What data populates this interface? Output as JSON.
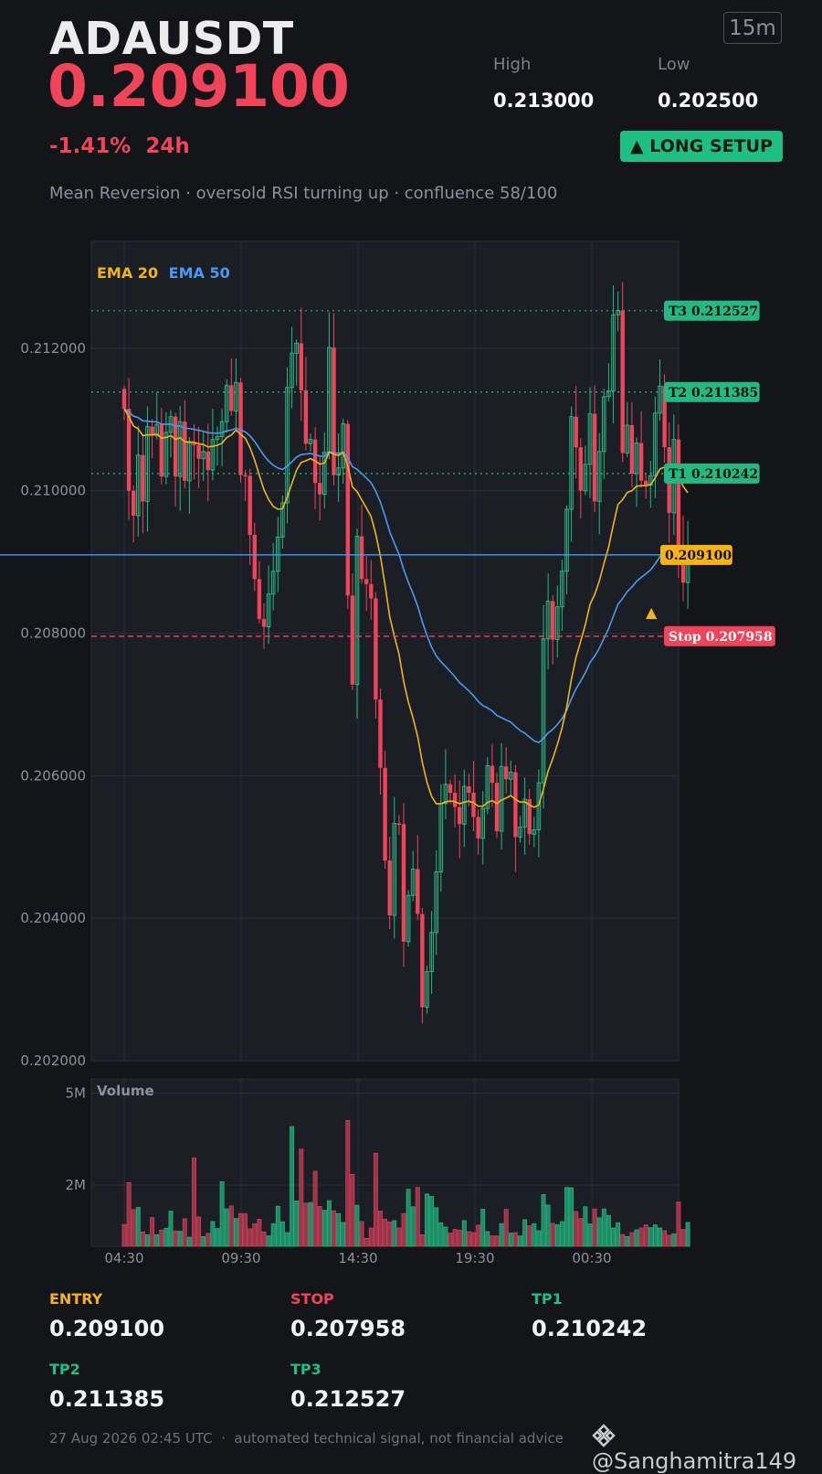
{
  "header": {
    "symbol": "ADAUSDT",
    "price": "0.209100",
    "interval": "15m",
    "high_label": "High",
    "high_value": "0.213000",
    "low_label": "Low",
    "low_value": "0.202500",
    "change": "-1.41%  24h",
    "signal": "▲ LONG SETUP",
    "strategy": "Mean Reversion · oversold RSI turning up · confluence 58/100"
  },
  "chart_data": [
    {
      "type": "candlestick",
      "legend": [
        {
          "name": "EMA 20",
          "color": "#f2b418"
        },
        {
          "name": "EMA 50",
          "color": "#4a9bf0"
        }
      ],
      "y_ticks": [
        "0.212000",
        "0.210000",
        "0.208000",
        "0.206000",
        "0.204000",
        "0.202000"
      ],
      "ylim": [
        0.202,
        0.2135
      ],
      "x_ticks": [
        "04:30",
        "09:30",
        "14:30",
        "19:30",
        "00:30"
      ],
      "levels": [
        {
          "name": "T3",
          "value": 0.212527,
          "label": "T3 0.212527",
          "color": "#26b883"
        },
        {
          "name": "T2",
          "value": 0.211385,
          "label": "T2 0.211385",
          "color": "#26b883"
        },
        {
          "name": "T1",
          "value": 0.210242,
          "label": "T1 0.210242",
          "color": "#26b883"
        },
        {
          "name": "Last",
          "value": 0.2091,
          "label": "0.209100",
          "color": "#f5b316"
        },
        {
          "name": "Stop",
          "value": 0.207958,
          "label": "Stop 0.207958",
          "color": "#f0445a"
        }
      ],
      "entry_marker": "▲",
      "close": [
        0.21115,
        0.21,
        0.20965,
        0.2105,
        0.20985,
        0.2109,
        0.21077,
        0.21093,
        0.2102,
        0.21082,
        0.21104,
        0.2102,
        0.21097,
        0.21014,
        0.21067,
        0.21064,
        0.21045,
        0.21055,
        0.21029,
        0.21072,
        0.21076,
        0.21097,
        0.21148,
        0.21112,
        0.21152,
        0.21022,
        0.21021,
        0.20938,
        0.20876,
        0.2082,
        0.20809,
        0.20855,
        0.20887,
        0.20935,
        0.20983,
        0.21145,
        0.21193,
        0.21207,
        0.21141,
        0.21066,
        0.21072,
        0.21011,
        0.20995,
        0.21054,
        0.21201,
        0.21022,
        0.21032,
        0.21094,
        0.20853,
        0.20728,
        0.20936,
        0.20876,
        0.20869,
        0.20849,
        0.20707,
        0.20611,
        0.20481,
        0.20404,
        0.20533,
        0.20532,
        0.20367,
        0.20432,
        0.20469,
        0.20406,
        0.20275,
        0.20325,
        0.2038,
        0.20465,
        0.20561,
        0.20588,
        0.20576,
        0.20556,
        0.20532,
        0.20585,
        0.20576,
        0.20542,
        0.20512,
        0.20554,
        0.20614,
        0.2059,
        0.20522,
        0.20613,
        0.20595,
        0.20605,
        0.20514,
        0.20528,
        0.20567,
        0.20518,
        0.20524,
        0.2059,
        0.20792,
        0.20845,
        0.20791,
        0.20837,
        0.20887,
        0.20974,
        0.21104,
        0.21061,
        0.21,
        0.21037,
        0.21108,
        0.20985,
        0.21055,
        0.21132,
        0.2114,
        0.21247,
        0.21253,
        0.21053,
        0.21092,
        0.21024,
        0.21067,
        0.21014,
        0.21008,
        0.21021,
        0.21109,
        0.21147,
        0.21061,
        0.20969,
        0.21072,
        0.20916,
        0.20871,
        0.2091
      ]
    },
    {
      "type": "bar",
      "title": "Volume",
      "y_ticks": [
        "5M",
        "2M"
      ],
      "values": [
        0.71,
        2.08,
        1.2,
        1.27,
        0.47,
        0.38,
        0.94,
        0.38,
        0.53,
        0.59,
        1.15,
        0.5,
        0.49,
        0.9,
        0.3,
        2.89,
        0.96,
        0.32,
        0.42,
        0.81,
        0.58,
        2.11,
        1.22,
        1.32,
        0.91,
        1.07,
        1.06,
        0.57,
        0.74,
        0.88,
        0.47,
        0.34,
        0.74,
        1.31,
        0.8,
        0.45,
        3.91,
        1.48,
        3.17,
        1.41,
        1.43,
        2.45,
        1.3,
        1.18,
        1.49,
        1.16,
        1.07,
        0.78,
        4.11,
        2.35,
        1.34,
        0.81,
        0.26,
        0.6,
        3.04,
        1.15,
        0.89,
        0.8,
        0.84,
        0.6,
        1.07,
        1.86,
        1.29,
        1.92,
        0.38,
        1.71,
        1.63,
        1.26,
        0.77,
        0.63,
        0.43,
        0.55,
        0.53,
        0.84,
        0.48,
        0.45,
        0.69,
        1.21,
        0.48,
        0.34,
        0.34,
        0.74,
        1.21,
        0.43,
        0.45,
        0.34,
        0.87,
        0.67,
        0.74,
        0.51,
        1.69,
        1.35,
        0.75,
        0.71,
        0.81,
        1.92,
        1.91,
        1.14,
        0.91,
        1.29,
        0.73,
        1.22,
        0.93,
        1.22,
        1.01,
        0.6,
        0.77,
        0.39,
        0.32,
        0.45,
        0.54,
        0.6,
        0.7,
        0.61,
        0.7,
        0.6,
        0.51,
        0.36,
        0.41,
        1.45,
        0.55,
        0.78
      ]
    }
  ],
  "summary": [
    {
      "label": "ENTRY",
      "value": "0.209100",
      "color": "#f5b316"
    },
    {
      "label": "STOP",
      "value": "0.207958",
      "color": "#f0445a"
    },
    {
      "label": "TP1",
      "value": "0.210242",
      "color": "#1fbe83"
    },
    {
      "label": "TP2",
      "value": "0.211385",
      "color": "#1fbe83"
    },
    {
      "label": "TP3",
      "value": "0.212527",
      "color": "#1fbe83"
    }
  ],
  "footer": {
    "text": "27 Aug 2026 02:45 UTC  ·  automated technical signal, not financial advice",
    "handle": "@Sanghamitra149"
  }
}
